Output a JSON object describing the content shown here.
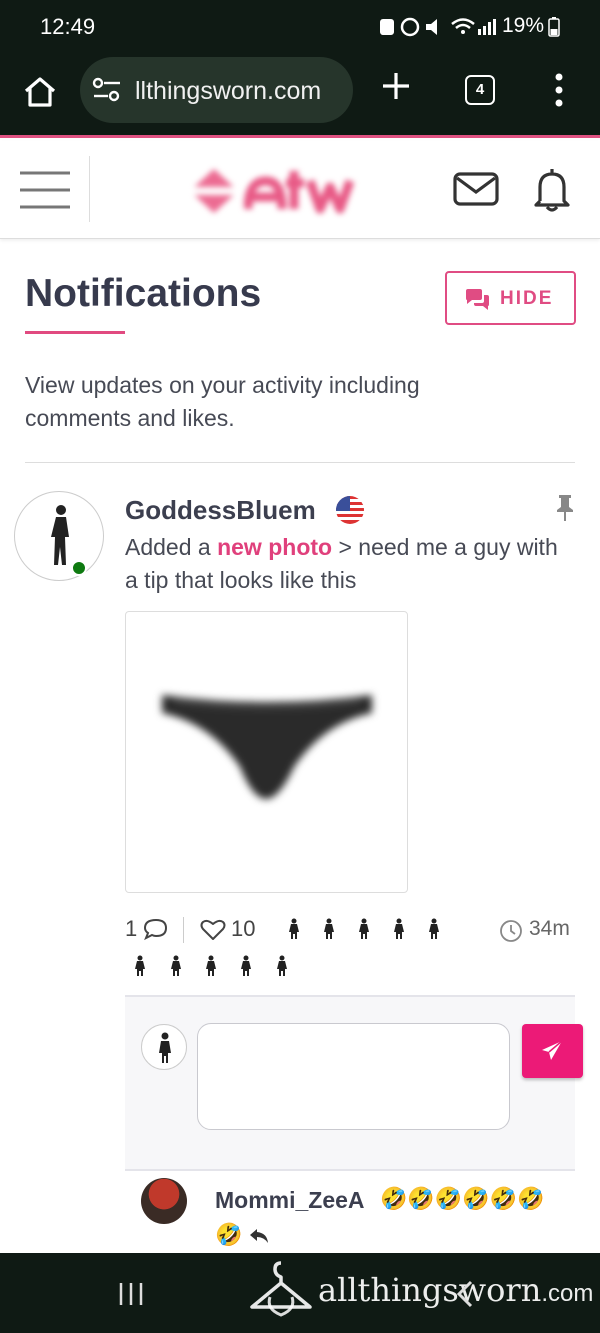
{
  "status_bar": {
    "time": "12:49",
    "battery": "19%"
  },
  "browser": {
    "url": "llthingsworn.com",
    "tab_count": "4"
  },
  "page": {
    "title": "Notifications",
    "hide_button": "HIDE",
    "description": "View updates on your activity including comments and likes."
  },
  "notification": {
    "username": "GoddessBluem",
    "message_prefix": "Added a ",
    "message_link": "new photo",
    "message_suffix": " > need me a guy with a tip that looks like this",
    "comment_count": "1",
    "like_count": "10",
    "time_ago": "34m"
  },
  "reply": {
    "username": "Mommi_ZeeA",
    "text": "🤣🤣🤣🤣🤣🤣",
    "text_line2": "🤣"
  },
  "watermark": {
    "text": "allthingsworn",
    "suffix": ".com"
  },
  "colors": {
    "brand_pink": "#e04c83",
    "send_button": "#ec1a77",
    "online": "#0e7a10",
    "system_bar": "#0f1a14"
  }
}
